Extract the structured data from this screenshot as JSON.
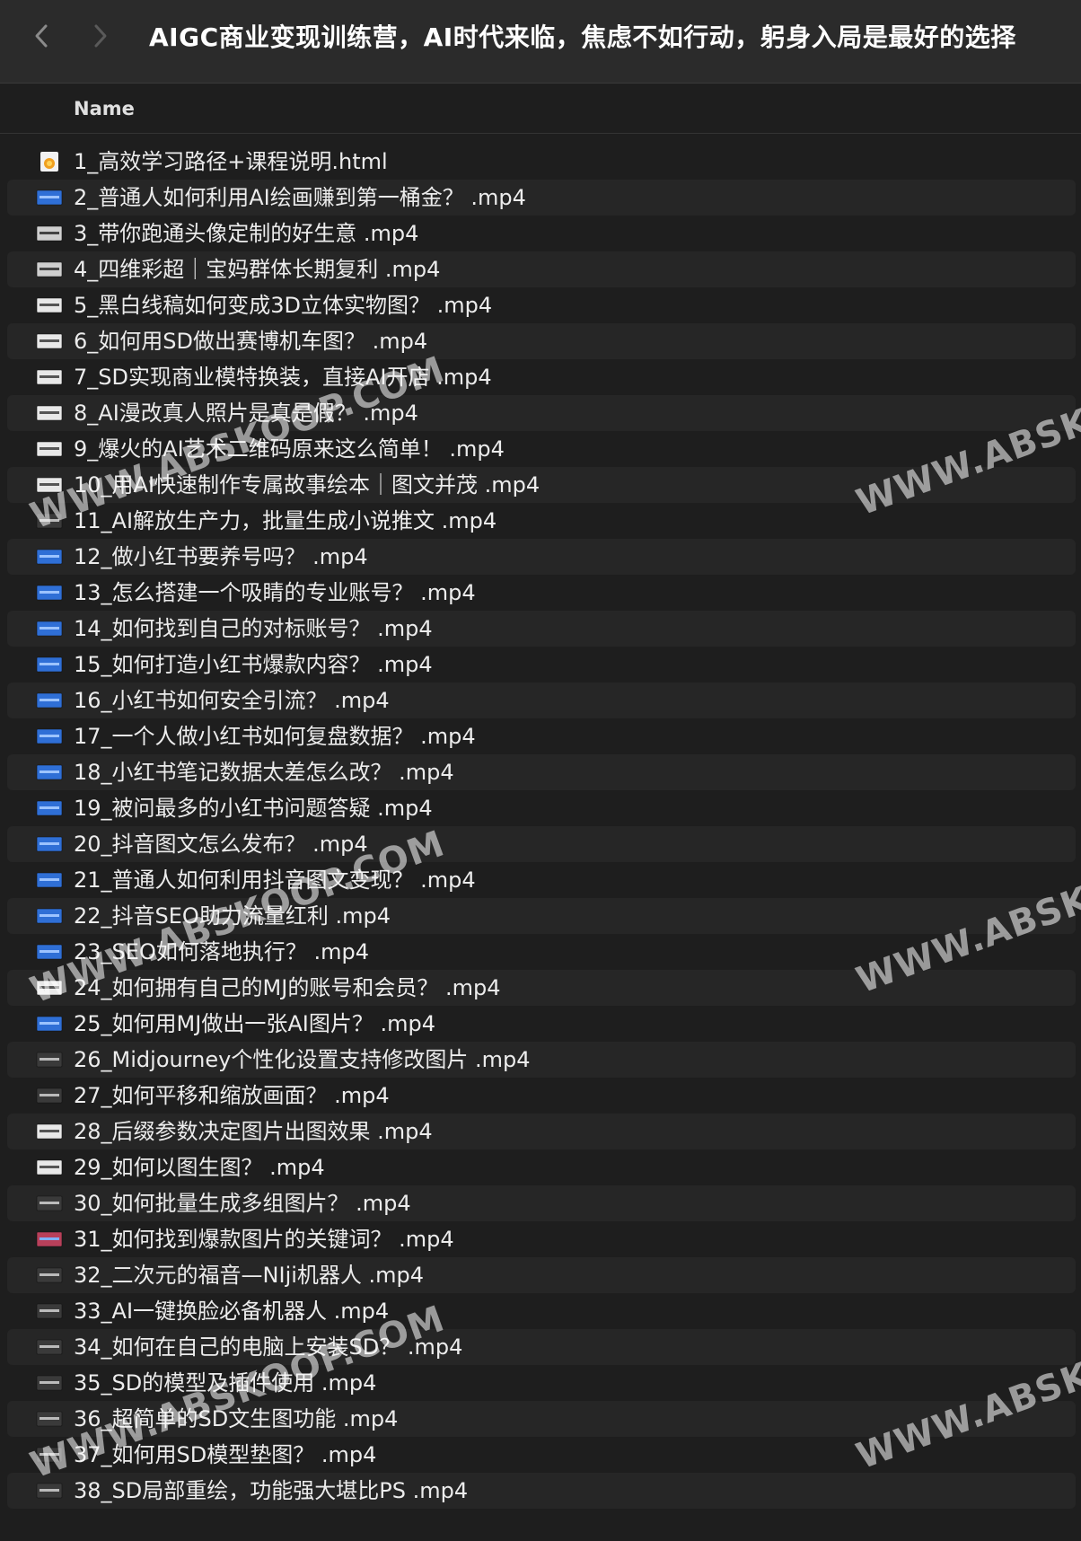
{
  "window": {
    "title": "AIGC商业变现训练营，AI时代来临，焦虑不如行动，躬身入局是最好的选择",
    "back_icon": "chevron-left-icon",
    "forward_icon": "chevron-right-icon"
  },
  "columns": {
    "name": "Name"
  },
  "files": [
    {
      "name": "1_高效学习路径+课程说明.html",
      "icon": "html-file-icon"
    },
    {
      "name": "2_普通人如何利用AI绘画赚到第一桶金？ .mp4",
      "icon": "video-thumbnail-icon"
    },
    {
      "name": "3_带你跑通头像定制的好生意 .mp4",
      "icon": "video-thumbnail-icon"
    },
    {
      "name": "4_四维彩超｜宝妈群体长期复利 .mp4",
      "icon": "video-thumbnail-icon"
    },
    {
      "name": "5_黑白线稿如何变成3D立体实物图？ .mp4",
      "icon": "video-thumbnail-icon"
    },
    {
      "name": "6_如何用SD做出赛博机车图？ .mp4",
      "icon": "video-thumbnail-icon"
    },
    {
      "name": "7_SD实现商业模特换装，直接AI开店 .mp4",
      "icon": "video-thumbnail-icon"
    },
    {
      "name": "8_AI漫改真人照片是真是假？ .mp4",
      "icon": "video-thumbnail-icon"
    },
    {
      "name": "9_爆火的AI艺术二维码原来这么简单！ .mp4",
      "icon": "video-thumbnail-icon"
    },
    {
      "name": "10_用AI快速制作专属故事绘本｜图文并茂 .mp4",
      "icon": "video-thumbnail-icon"
    },
    {
      "name": "11_AI解放生产力，批量生成小说推文 .mp4",
      "icon": "video-thumbnail-icon"
    },
    {
      "name": "12_做小红书要养号吗？ .mp4",
      "icon": "video-thumbnail-icon"
    },
    {
      "name": "13_怎么搭建一个吸睛的专业账号？ .mp4",
      "icon": "video-thumbnail-icon"
    },
    {
      "name": "14_如何找到自己的对标账号？ .mp4",
      "icon": "video-thumbnail-icon"
    },
    {
      "name": "15_如何打造小红书爆款内容？ .mp4",
      "icon": "video-thumbnail-icon"
    },
    {
      "name": "16_小红书如何安全引流？ .mp4",
      "icon": "video-thumbnail-icon"
    },
    {
      "name": "17_一个人做小红书如何复盘数据？ .mp4",
      "icon": "video-thumbnail-icon"
    },
    {
      "name": "18_小红书笔记数据太差怎么改？ .mp4",
      "icon": "video-thumbnail-icon"
    },
    {
      "name": "19_被问最多的小红书问题答疑 .mp4",
      "icon": "video-thumbnail-icon"
    },
    {
      "name": "20_抖音图文怎么发布？ .mp4",
      "icon": "video-thumbnail-icon"
    },
    {
      "name": "21_普通人如何利用抖音图文变现？ .mp4",
      "icon": "video-thumbnail-icon"
    },
    {
      "name": "22_抖音SEO助力流量红利 .mp4",
      "icon": "video-thumbnail-icon"
    },
    {
      "name": "23_SEO如何落地执行？ .mp4",
      "icon": "video-thumbnail-icon"
    },
    {
      "name": "24_如何拥有自己的MJ的账号和会员？ .mp4",
      "icon": "video-thumbnail-icon"
    },
    {
      "name": "25_如何用MJ做出一张AI图片？ .mp4",
      "icon": "video-thumbnail-icon"
    },
    {
      "name": "26_Midjourney个性化设置支持修改图片 .mp4",
      "icon": "video-thumbnail-icon"
    },
    {
      "name": "27_如何平移和缩放画面？ .mp4",
      "icon": "video-thumbnail-icon"
    },
    {
      "name": "28_后缀参数决定图片出图效果 .mp4",
      "icon": "video-thumbnail-icon"
    },
    {
      "name": "29_如何以图生图？ .mp4",
      "icon": "video-thumbnail-icon"
    },
    {
      "name": "30_如何批量生成多组图片？ .mp4",
      "icon": "video-thumbnail-icon"
    },
    {
      "name": "31_如何找到爆款图片的关键词？ .mp4",
      "icon": "video-thumbnail-icon"
    },
    {
      "name": "32_二次元的福音—NIji机器人 .mp4",
      "icon": "video-thumbnail-icon"
    },
    {
      "name": "33_AI一键换脸必备机器人 .mp4",
      "icon": "video-thumbnail-icon"
    },
    {
      "name": "34_如何在自己的电脑上安装SD？ .mp4",
      "icon": "video-thumbnail-icon"
    },
    {
      "name": "35_SD的模型及插件使用 .mp4",
      "icon": "video-thumbnail-icon"
    },
    {
      "name": "36_超简单的SD文生图功能 .mp4",
      "icon": "video-thumbnail-icon"
    },
    {
      "name": "37_如何用SD模型垫图？ .mp4",
      "icon": "video-thumbnail-icon"
    },
    {
      "name": "38_SD局部重绘，功能强大堪比PS .mp4",
      "icon": "video-thumbnail-icon"
    }
  ],
  "watermark": {
    "text": "WWW.ABSKOOP.COM",
    "right_text": "WWW.ABSKO"
  },
  "colors": {
    "background": "#1e1e1e",
    "titlebar": "#2b2b2b",
    "row_alt": "#262626",
    "text": "#ececec",
    "thumb_blue": "#2f6fd6"
  }
}
